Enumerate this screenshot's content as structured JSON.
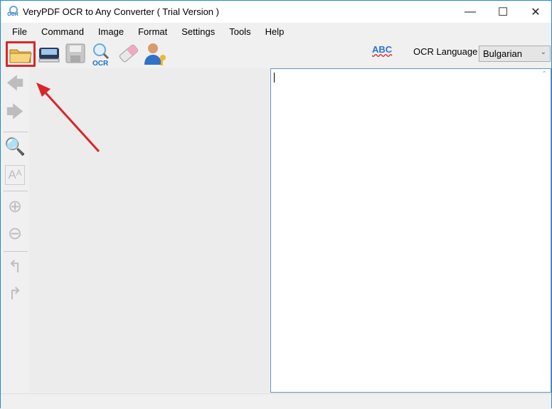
{
  "window": {
    "title": "VeryPDF OCR to Any Converter  ( Trial Version )",
    "app_icon_text": "OCR",
    "minimize": "—",
    "maximize": "☐",
    "close": "✕"
  },
  "menu": [
    "File",
    "Command",
    "Image",
    "Format",
    "Settings",
    "Tools",
    "Help"
  ],
  "toolbar": {
    "spell_check_label": "ABC",
    "ocr_language_label": "OCR Language",
    "ocr_language_value": "Bulgarian",
    "ocr_icon_text": "OCR"
  },
  "colors": {
    "highlight": "#d9262a",
    "accent": "#1e88d8"
  }
}
